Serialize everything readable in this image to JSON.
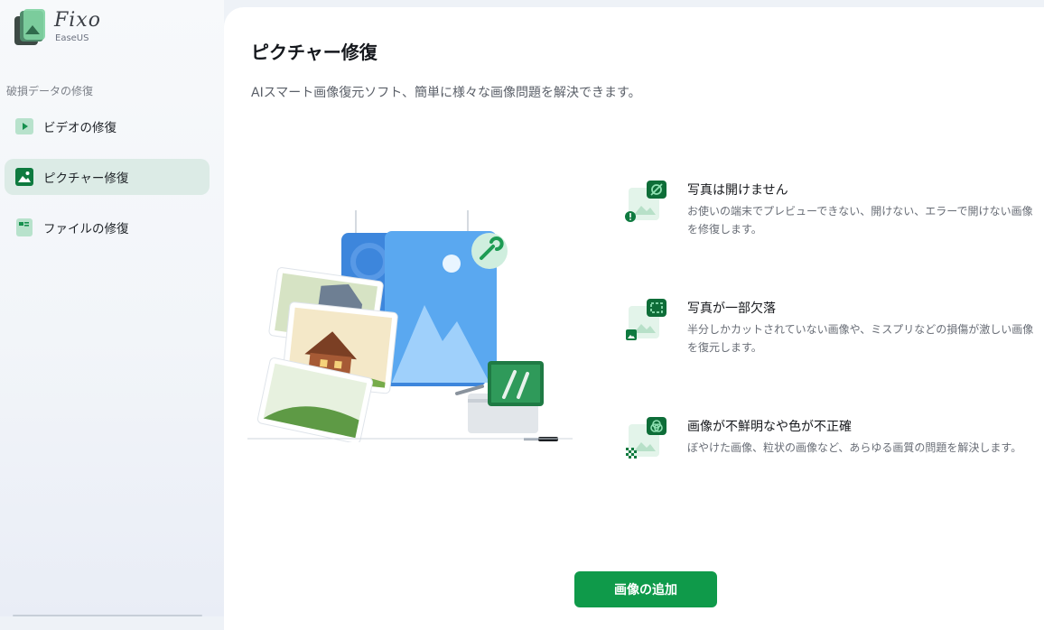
{
  "app": {
    "brand_name": "Fixo",
    "brand_sub": "EaseUS"
  },
  "sidebar": {
    "section_title": "破損データの修復",
    "items": [
      {
        "label": "ビデオの修復",
        "icon": "video-icon",
        "active": false
      },
      {
        "label": "ピクチャー修復",
        "icon": "picture-icon",
        "active": true
      },
      {
        "label": "ファイルの修復",
        "icon": "file-icon",
        "active": false
      }
    ]
  },
  "main": {
    "title": "ピクチャー修復",
    "description": "AIスマート画像復元ソフト、簡単に様々な画像問題を解決できます。",
    "features": [
      {
        "icon": "unreadable-photo-icon",
        "title": "写真は開けません",
        "desc": "お使いの端末でプレビューできない、開けない、エラーで開けない画像を修復します。"
      },
      {
        "icon": "partial-photo-icon",
        "title": "写真が一部欠落",
        "desc": "半分しかカットされていない画像や、ミスプリなどの損傷が激しい画像を復元します。"
      },
      {
        "icon": "blurry-photo-icon",
        "title": "画像が不鮮明なや色が不正確",
        "desc": "ぼやけた画像、粒状の画像など、あらゆる画質の問題を解決します。"
      }
    ],
    "add_button_label": "画像の追加"
  },
  "colors": {
    "accent": "#0f9a4a",
    "active_nav_bg": "#dcebe6",
    "icon_green": "#0e7a3f"
  }
}
